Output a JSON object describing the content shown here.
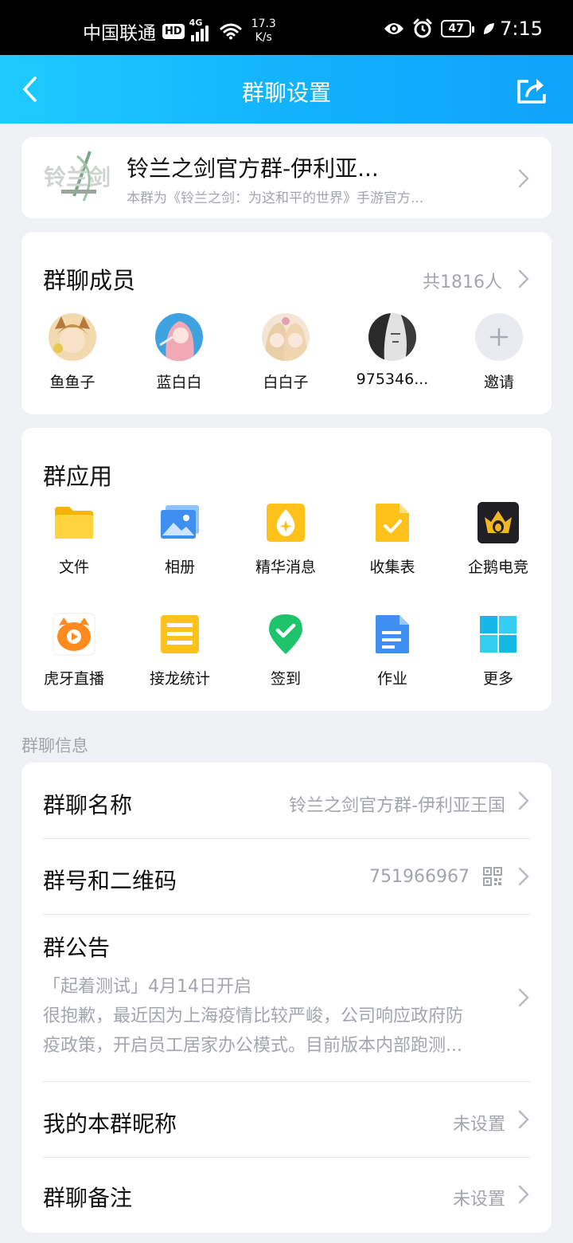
{
  "status_bar": {
    "carrier": "中国联通",
    "hd": "HD",
    "network": "4G",
    "speed_value": "17.3",
    "speed_unit": "K/s",
    "battery": "47",
    "time": "7:15",
    "icons": [
      "eye-icon",
      "alarm-icon",
      "leaf-icon",
      "wifi-icon",
      "signal-icon"
    ]
  },
  "header": {
    "title": "群聊设置",
    "back_icon": "chevron-left-icon",
    "share_icon": "share-icon"
  },
  "group": {
    "name": "铃兰之剑官方群-伊利亚...",
    "description": "本群为《铃兰之剑：为这和平的世界》手游官方..."
  },
  "members": {
    "title": "群聊成员",
    "count": "共1816人",
    "list": [
      {
        "name": "鱼鱼子"
      },
      {
        "name": "蓝白白"
      },
      {
        "name": "白白子"
      },
      {
        "name": "975346..."
      }
    ],
    "invite_label": "邀请"
  },
  "apps": {
    "title": "群应用",
    "items": [
      {
        "label": "文件",
        "icon": "folder-icon"
      },
      {
        "label": "相册",
        "icon": "photo-album-icon"
      },
      {
        "label": "精华消息",
        "icon": "essence-icon"
      },
      {
        "label": "收集表",
        "icon": "collect-form-icon"
      },
      {
        "label": "企鹅电竞",
        "icon": "penguin-esports-icon"
      },
      {
        "label": "虎牙直播",
        "icon": "huya-live-icon"
      },
      {
        "label": "接龙统计",
        "icon": "chain-stats-icon"
      },
      {
        "label": "签到",
        "icon": "check-in-icon"
      },
      {
        "label": "作业",
        "icon": "homework-icon"
      },
      {
        "label": "更多",
        "icon": "more-grid-icon"
      }
    ]
  },
  "info": {
    "section_label": "群聊信息",
    "name_row": {
      "title": "群聊名称",
      "value": "铃兰之剑官方群-伊利亚王国"
    },
    "id_row": {
      "title": "群号和二维码",
      "value": "751966967"
    },
    "notice_row": {
      "title": "群公告",
      "line1": "「起着测试」4月14日开启",
      "line2": "很抱歉，最近因为上海疫情比较严峻，公司响应政府防",
      "line3": "疫政策，开启员工居家办公模式。目前版本内部跑测..."
    },
    "nickname_row": {
      "title": "我的本群昵称",
      "value": "未设置"
    },
    "remark_row": {
      "title": "群聊备注",
      "value": "未设置"
    }
  },
  "colors": {
    "header_start": "#1ecbff",
    "header_end": "#0fa3fb",
    "background": "#f0f1f5",
    "muted_text": "#a3a5ad"
  }
}
